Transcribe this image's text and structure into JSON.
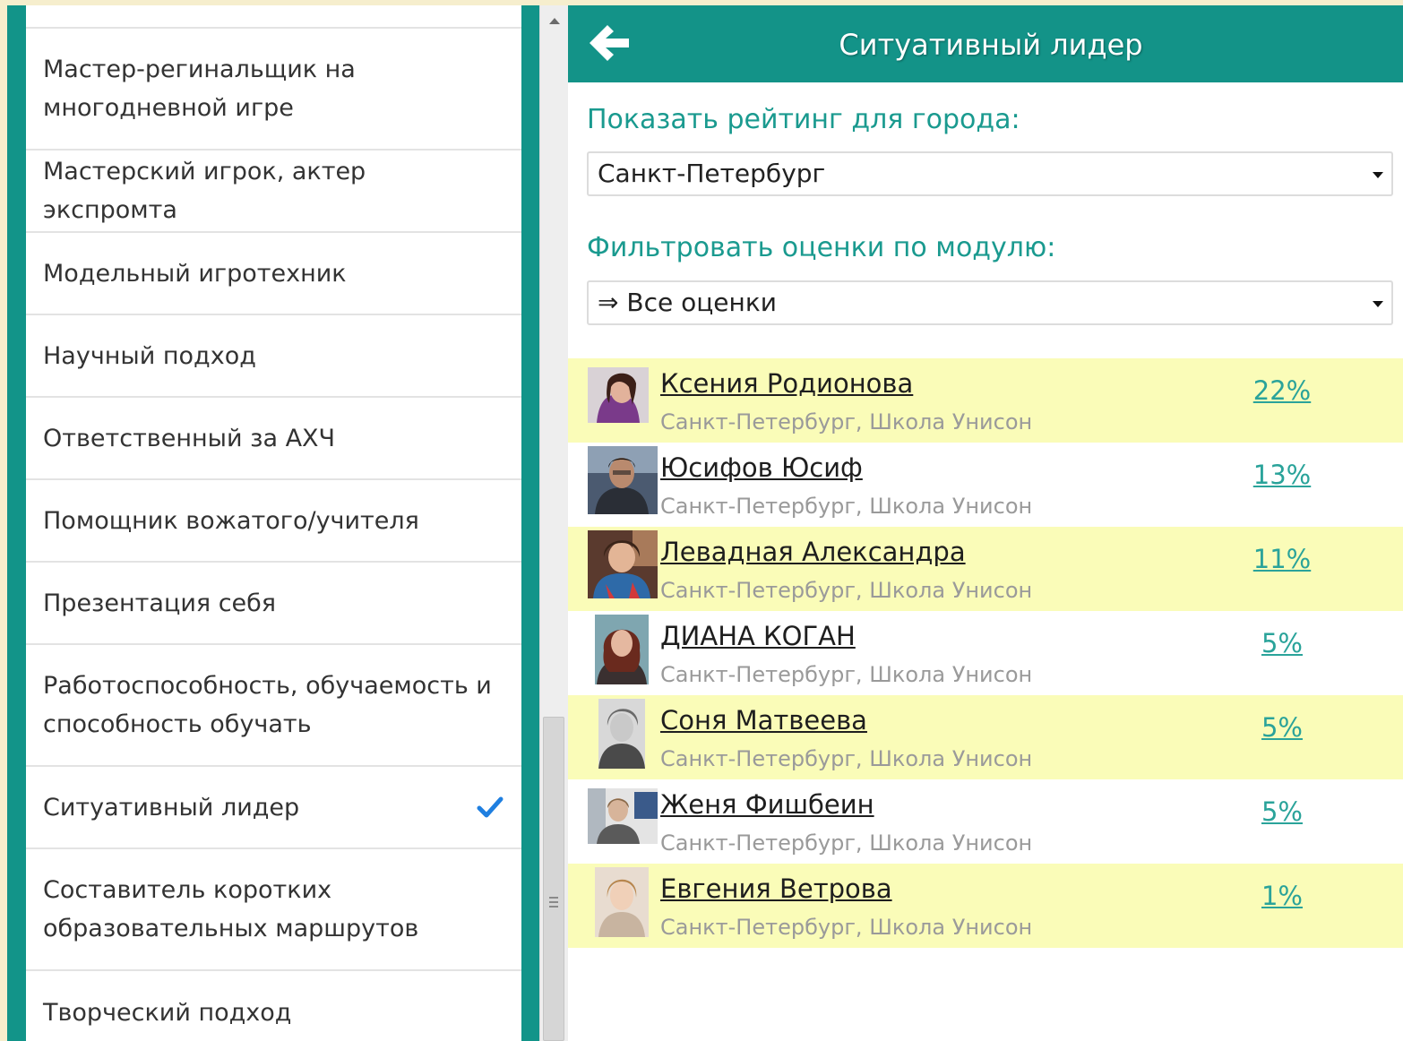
{
  "sidebar": {
    "items": [
      {
        "label": "Мастер-регинальщик на многодневной игре",
        "selected": false
      },
      {
        "label": "Мастерский игрок, актер экспромта",
        "selected": false
      },
      {
        "label": "Модельный игротехник",
        "selected": false
      },
      {
        "label": "Научный подход",
        "selected": false
      },
      {
        "label": "Ответственный за АХЧ",
        "selected": false
      },
      {
        "label": "Помощник вожатого/учителя",
        "selected": false
      },
      {
        "label": "Презентация себя",
        "selected": false
      },
      {
        "label": "Работоспособность, обучаемость и способность обучать",
        "selected": false
      },
      {
        "label": "Ситуативный лидер",
        "selected": true
      },
      {
        "label": "Составитель коротких образовательных маршрутов",
        "selected": false
      },
      {
        "label": "Творческий подход",
        "selected": false
      }
    ]
  },
  "header": {
    "title": "Ситуативный лидер",
    "back_icon": "arrow-left-icon"
  },
  "filters": {
    "city_label": "Показать рейтинг для города:",
    "city_value": "Санкт-Петербург",
    "module_label": "Фильтровать оценки по модулю:",
    "module_value": "⇒ Все оценки"
  },
  "rating": [
    {
      "name": "Ксения Родионова",
      "city": "Санкт-Петербург, Школа Унисон",
      "score": "22%"
    },
    {
      "name": "Юсифов Юсиф",
      "city": "Санкт-Петербург, Школа Унисон",
      "score": "13%"
    },
    {
      "name": "Левадная Александра",
      "city": "Санкт-Петербург, Школа Унисон",
      "score": "11%"
    },
    {
      "name": "ДИАНА КОГАН",
      "city": "Санкт-Петербург, Школа Унисон",
      "score": "5%"
    },
    {
      "name": "Соня Матвеева",
      "city": "Санкт-Петербург, Школа Унисон",
      "score": "5%"
    },
    {
      "name": "Женя Фишбеин",
      "city": "Санкт-Петербург, Школа Унисон",
      "score": "5%"
    },
    {
      "name": "Евгения Ветрова",
      "city": "Санкт-Петербург, Школа Унисон",
      "score": "1%"
    }
  ],
  "colors": {
    "teal": "#139388",
    "row_highlight": "#fafcb8",
    "link_score": "#2aa39a",
    "check": "#1f7fe0"
  }
}
